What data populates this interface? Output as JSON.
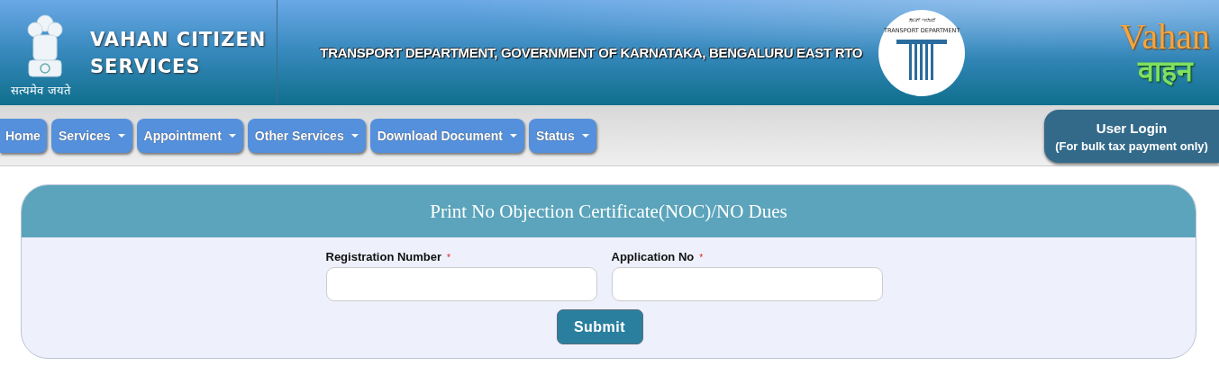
{
  "header": {
    "emblem_motto": "सत्यमेव जयते",
    "site_title_lines": [
      "VAHAN CITIZEN",
      "SERVICES"
    ],
    "department": "TRANSPORT DEPARTMENT, GOVERNMENT OF KARNATAKA, BENGALURU EAST RTO",
    "dept_logo": {
      "top_text": "ಸಾರಿಗೆ ಇಲಾಖೆ",
      "bottom_text": "TRANSPORT DEPARTMENT"
    },
    "brand_logo": {
      "latin": "Vahan",
      "devanagari": "वाहन"
    }
  },
  "nav": {
    "items": [
      {
        "label": "Home",
        "has_dropdown": false
      },
      {
        "label": "Services",
        "has_dropdown": true
      },
      {
        "label": "Appointment",
        "has_dropdown": true
      },
      {
        "label": "Other Services",
        "has_dropdown": true
      },
      {
        "label": "Download Document",
        "has_dropdown": true
      },
      {
        "label": "Status",
        "has_dropdown": true
      }
    ],
    "login": {
      "label": "User Login",
      "note": "(For bulk tax payment only)"
    }
  },
  "form": {
    "title": "Print No Objection Certificate(NOC)/NO Dues",
    "fields": [
      {
        "label": "Registration Number",
        "required_mark": "*"
      },
      {
        "label": "Application No",
        "required_mark": "*"
      }
    ],
    "submit": "Submit"
  }
}
